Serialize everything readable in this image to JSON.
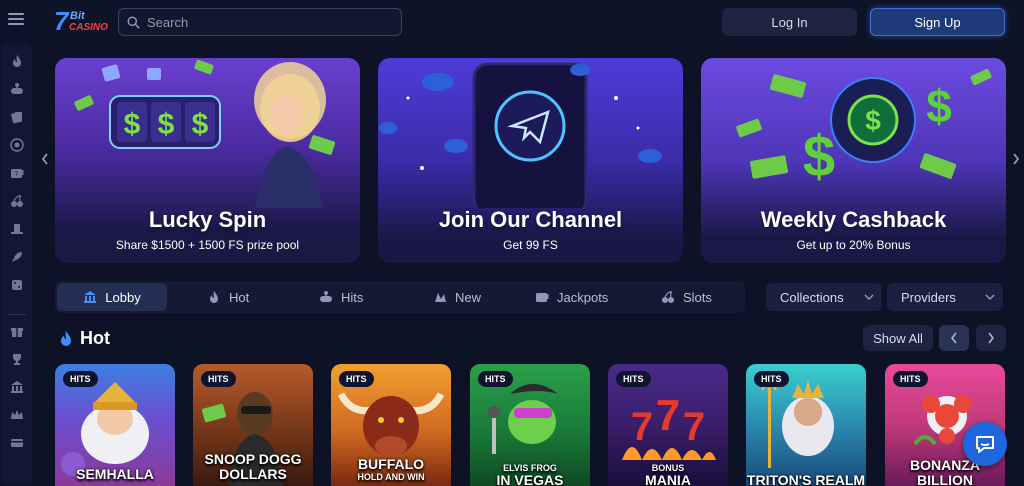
{
  "header": {
    "logo_seven": "7",
    "logo_bit": "Bit",
    "logo_casino": "CASINO",
    "search_placeholder": "Search",
    "login_label": "Log In",
    "signup_label": "Sign Up"
  },
  "sidebar": {
    "items": [
      "fire-icon",
      "joystick-icon",
      "cards-icon",
      "target-icon",
      "slots-icon",
      "cherries-icon",
      "hat-icon",
      "rocket-icon",
      "dice-icon",
      "gift-icon",
      "trophy-icon",
      "bank-icon",
      "crown-icon",
      "card-icon"
    ]
  },
  "banners": [
    {
      "title": "Lucky Spin",
      "subtitle": "Share $1500 + 1500 FS prize pool"
    },
    {
      "title": "Join Our Channel",
      "subtitle": "Get 99 FS"
    },
    {
      "title": "Weekly Cashback",
      "subtitle": "Get up to 20% Bonus"
    }
  ],
  "tabs": [
    {
      "label": "Lobby",
      "icon": "lobby-icon",
      "active": true
    },
    {
      "label": "Hot",
      "icon": "fire-icon"
    },
    {
      "label": "Hits",
      "icon": "joystick-icon"
    },
    {
      "label": "New",
      "icon": "new-icon"
    },
    {
      "label": "Jackpots",
      "icon": "jackpot-icon"
    },
    {
      "label": "Slots",
      "icon": "cherries-icon"
    }
  ],
  "filters": {
    "collections_label": "Collections",
    "providers_label": "Providers"
  },
  "section": {
    "title": "Hot",
    "show_all_label": "Show All"
  },
  "games": [
    {
      "badge": "HITS",
      "name": "SEMHALLA"
    },
    {
      "badge": "HITS",
      "name": "SNOOP DOGG DOLLARS"
    },
    {
      "badge": "HITS",
      "name": "BUFFALO",
      "sub": "HOLD AND WIN"
    },
    {
      "badge": "HITS",
      "name": "ELVIS FROG",
      "sub": "IN VEGAS"
    },
    {
      "badge": "HITS",
      "name": "BONUS",
      "sub": "MANIA"
    },
    {
      "badge": "HITS",
      "name": "TRITON'S REALM"
    },
    {
      "badge": "HITS",
      "name": "BONANZA BILLION"
    }
  ],
  "colors": {
    "background": "#0d1226",
    "accent": "#3f6fdc",
    "chat": "#1d66e0"
  }
}
